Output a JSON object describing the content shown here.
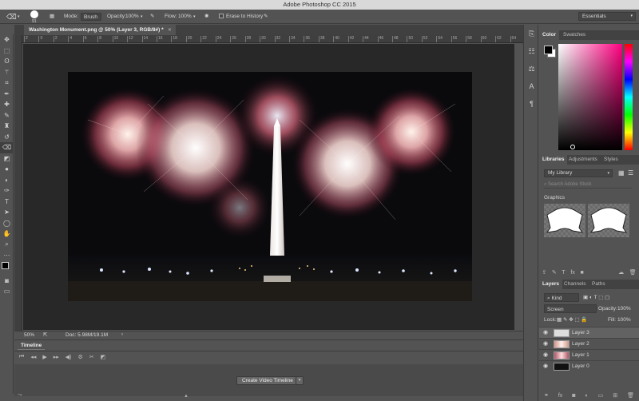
{
  "app": {
    "title": "Adobe Photoshop CC 2015"
  },
  "options_bar": {
    "brush_size": "91",
    "mode_label": "Mode:",
    "mode_value": "Brush",
    "opacity_label": "Opacity:",
    "opacity_value": "100%",
    "flow_label": "Flow:",
    "flow_value": "100%",
    "erase_to_history_label": "Erase to History",
    "workspace": "Essentials"
  },
  "document": {
    "tab_title": "Washington Monument.png @ 50% (Layer 3, RGB/8#) *",
    "ruler_ticks": [
      "2",
      "0",
      "2",
      "4",
      "6",
      "8",
      "10",
      "12",
      "14",
      "16",
      "18",
      "20",
      "22",
      "24",
      "26",
      "28",
      "30",
      "32",
      "34",
      "36",
      "38",
      "40",
      "42",
      "44",
      "46",
      "48",
      "50",
      "52",
      "54",
      "56",
      "58",
      "60",
      "62",
      "64"
    ]
  },
  "status": {
    "zoom": "50%",
    "doc_size": "Doc: 5.98M/19.1M"
  },
  "timeline": {
    "tab": "Timeline",
    "create_button": "Create Video Timeline"
  },
  "color_panel": {
    "tabs": [
      "Color",
      "Swatches"
    ]
  },
  "libraries_panel": {
    "tabs": [
      "Libraries",
      "Adjustments",
      "Styles"
    ],
    "library": "My Library",
    "search_placeholder": "Search Adobe Stock",
    "section": "Graphics"
  },
  "layers_panel": {
    "tabs": [
      "Layers",
      "Channels",
      "Paths"
    ],
    "filter": "Kind",
    "blend_mode": "Screen",
    "opacity_label": "Opacity:",
    "opacity_value": "100%",
    "lock_label": "Lock:",
    "fill_label": "Fill:",
    "fill_value": "100%",
    "layers": [
      {
        "name": "Layer 3",
        "selected": true
      },
      {
        "name": "Layer 2",
        "selected": false
      },
      {
        "name": "Layer 1",
        "selected": false
      },
      {
        "name": "Layer 0",
        "selected": false
      }
    ]
  }
}
